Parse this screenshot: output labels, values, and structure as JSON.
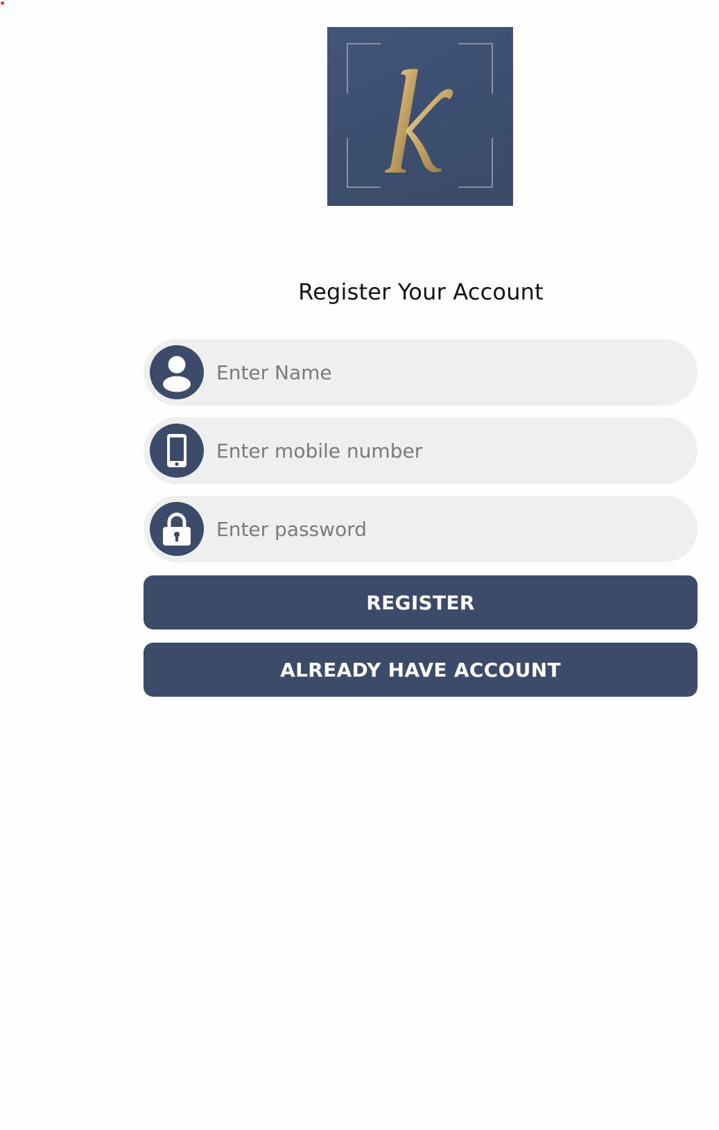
{
  "brand": {
    "logo_letter": "K",
    "colors": {
      "navy": "#3d4b6a",
      "gold": "#c9a866",
      "field_bg": "#efefef"
    }
  },
  "page": {
    "title": "Register Your Account"
  },
  "form": {
    "name": {
      "placeholder": "Enter Name",
      "value": "",
      "icon": "user-icon"
    },
    "mobile": {
      "placeholder": "Enter mobile number",
      "value": "",
      "icon": "phone-icon"
    },
    "password": {
      "placeholder": "Enter password",
      "value": "",
      "icon": "lock-icon"
    }
  },
  "actions": {
    "register_label": "REGISTER",
    "login_label": "ALREADY HAVE ACCOUNT"
  }
}
